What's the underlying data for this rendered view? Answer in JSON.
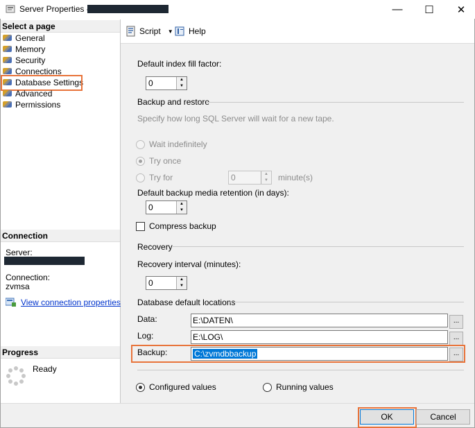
{
  "window": {
    "title": "Server Properties -",
    "minimize": "—",
    "maximize": "☐",
    "close": "✕"
  },
  "left": {
    "select_header": "Select a page",
    "pages": [
      {
        "label": "General"
      },
      {
        "label": "Memory"
      },
      {
        "label": "Security"
      },
      {
        "label": "Connections"
      },
      {
        "label": "Database Settings"
      },
      {
        "label": "Advanced"
      },
      {
        "label": "Permissions"
      }
    ],
    "connection_header": "Connection",
    "server_label": "Server:",
    "connection_label": "Connection:",
    "connection_value": "zvmsa",
    "view_link": "View connection properties",
    "progress_header": "Progress",
    "progress_status": "Ready"
  },
  "toolbar": {
    "script_label": "Script",
    "help_label": "Help"
  },
  "form": {
    "fill_factor_label": "Default index fill factor:",
    "fill_factor_value": "0",
    "backup_restore_label": "Backup and restore",
    "backup_hint": "Specify how long SQL Server will wait for a new tape.",
    "wait_indefinitely": "Wait indefinitely",
    "try_once": "Try once",
    "try_for": "Try for",
    "try_for_value": "0",
    "minutes_label": "minute(s)",
    "retention_label": "Default backup media retention (in days):",
    "retention_value": "0",
    "compress_label": "Compress backup",
    "recovery_label": "Recovery",
    "recovery_interval_label": "Recovery interval (minutes):",
    "recovery_interval_value": "0",
    "locations_label": "Database default locations",
    "data_label": "Data:",
    "data_value": "E:\\DATEN\\",
    "log_label": "Log:",
    "log_value": "E:\\LOG\\",
    "backup_label": "Backup:",
    "backup_value": "C:\\zvmdbbackup",
    "browse_label": "...",
    "configured_label": "Configured values",
    "running_label": "Running values"
  },
  "buttons": {
    "ok": "OK",
    "cancel": "Cancel"
  }
}
